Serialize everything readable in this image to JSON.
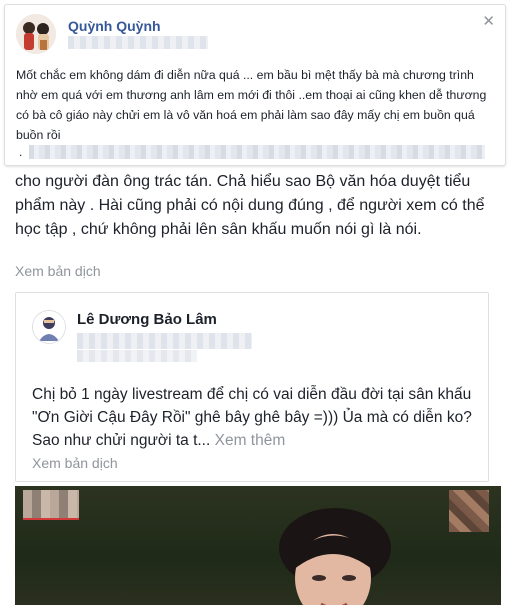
{
  "top_post": {
    "author": "Quỳnh Quỳnh",
    "text": "Mốt chắc em không dám đi diễn nữa quá ... em bầu bì mệt thấy bà mà chương trình nhờ em quá với em thương anh lâm em mới đi thôi ..em thoại ai cũng khen dễ thương có bà cô giáo này chửi em là vô văn hoá em phải làm sao đây mấy chị em buồn quá buồn rồi",
    "dot": "."
  },
  "comment": {
    "text": "cho người đàn ông trác tán. Chả hiểu sao Bộ văn hóa duyệt tiểu phẩm này . Hài cũng phải có nội dung đúng , để người xem có thể học tập , chứ không phải lên sân khấu muốn nói gì là nói.",
    "translate": "Xem bản dịch"
  },
  "shared_post": {
    "author": "Lê Dương Bảo Lâm",
    "text": "Chị bỏ 1 ngày livestream để chị có vai diễn đầu đời tại sân khấu \"Ơn Giời Cậu Đây Rồi\" ghê bây ghê bây =))) Ủa mà có diễn ko? Sao như chửi người ta t...",
    "see_more": "Xem thêm",
    "translate": "Xem bản dịch"
  },
  "icons": {
    "dismiss": "close-icon",
    "avatar1": "profile-photo",
    "avatar2": "profile-photo"
  },
  "colors": {
    "author_link": "#365899",
    "muted": "#90949c",
    "border": "#dddfe2"
  }
}
